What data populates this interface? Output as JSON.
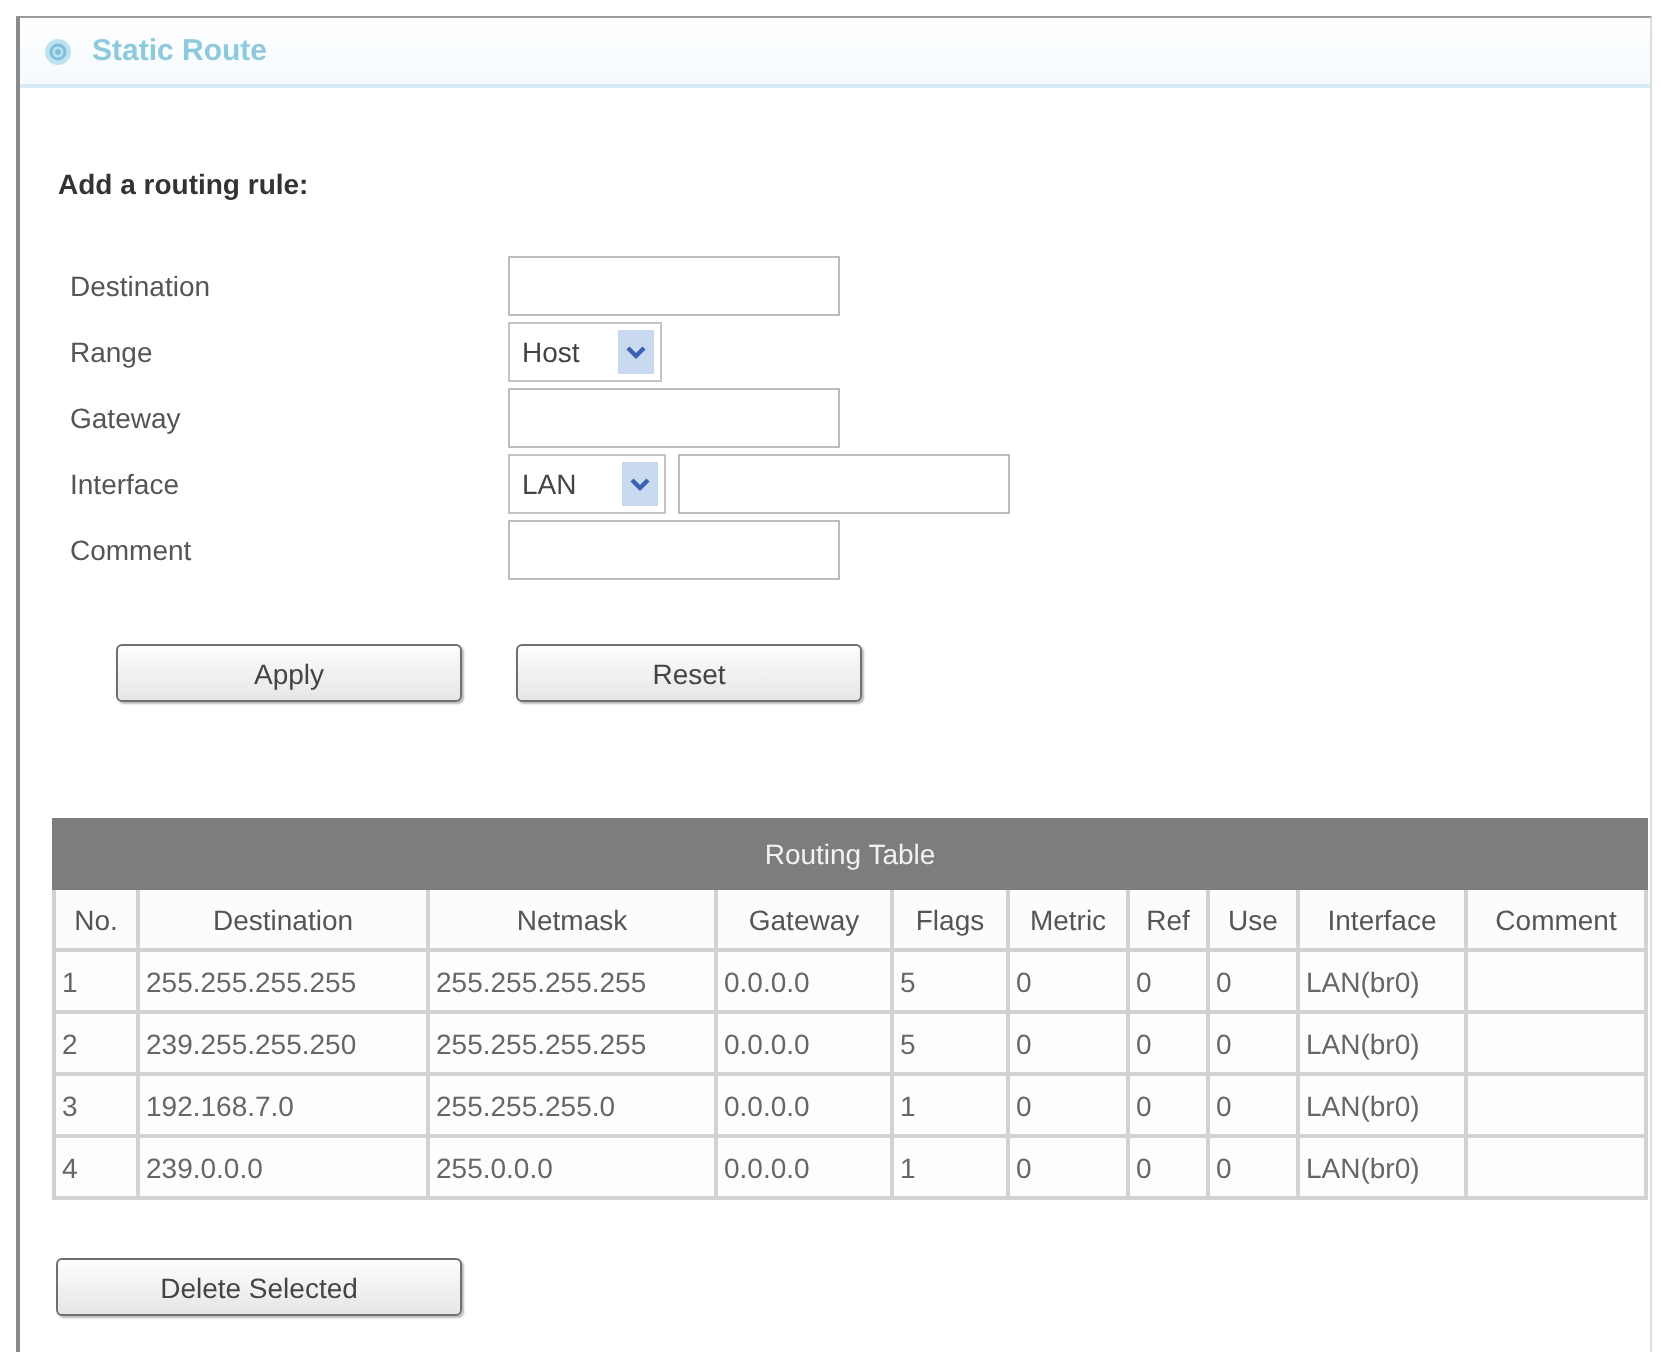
{
  "header": {
    "title": "Static Route"
  },
  "form": {
    "heading": "Add a routing rule:",
    "fields": [
      {
        "kind": "text",
        "label": "Destination"
      },
      {
        "kind": "select",
        "label": "Range",
        "value": "Host"
      },
      {
        "kind": "text",
        "label": "Gateway"
      },
      {
        "kind": "select_text",
        "label": "Interface",
        "value": "LAN"
      },
      {
        "kind": "text",
        "label": "Comment"
      }
    ],
    "buttons": [
      "Apply",
      "Reset"
    ]
  },
  "routing_table": {
    "title": "Routing Table",
    "columns": [
      "No.",
      "Destination",
      "Netmask",
      "Gateway",
      "Flags",
      "Metric",
      "Ref",
      "Use",
      "Interface",
      "Comment"
    ],
    "rows": [
      [
        "1",
        "255.255.255.255",
        "255.255.255.255",
        "0.0.0.0",
        "5",
        "0",
        "0",
        "0",
        "LAN(br0)"
      ],
      [
        "2",
        "239.255.255.250",
        "255.255.255.255",
        "0.0.0.0",
        "5",
        "0",
        "0",
        "0",
        "LAN(br0)"
      ],
      [
        "3",
        "192.168.7.0",
        "255.255.255.0",
        "0.0.0.0",
        "1",
        "0",
        "0",
        "0",
        "LAN(br0)"
      ],
      [
        "4",
        "239.0.0.0",
        "255.0.0.0",
        "0.0.0.0",
        "1",
        "0",
        "0",
        "0",
        "LAN(br0)"
      ]
    ]
  },
  "delete_button": "Delete Selected"
}
